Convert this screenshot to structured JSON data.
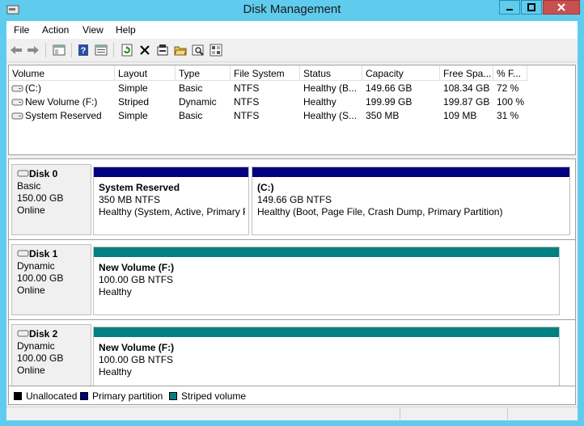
{
  "window": {
    "title": "Disk Management"
  },
  "menu": [
    "File",
    "Action",
    "View",
    "Help"
  ],
  "toolbar": {
    "icons": [
      "back-arrow-icon",
      "forward-arrow-icon",
      "console-tree-icon",
      "help-icon",
      "properties-icon",
      "refresh-icon",
      "delete-icon",
      "new-volume-icon",
      "open-icon",
      "explore-icon",
      "rescan-icon"
    ]
  },
  "volumes": {
    "columns": [
      "Volume",
      "Layout",
      "Type",
      "File System",
      "Status",
      "Capacity",
      "Free Spa...",
      "% F..."
    ],
    "rows": [
      {
        "volume": "(C:)",
        "layout": "Simple",
        "type": "Basic",
        "fs": "NTFS",
        "status": "Healthy (B...",
        "capacity": "149.66 GB",
        "free": "108.34 GB",
        "pct": "72 %"
      },
      {
        "volume": "New Volume (F:)",
        "layout": "Striped",
        "type": "Dynamic",
        "fs": "NTFS",
        "status": "Healthy",
        "capacity": "199.99 GB",
        "free": "199.87 GB",
        "pct": "100 %"
      },
      {
        "volume": "System Reserved",
        "layout": "Simple",
        "type": "Basic",
        "fs": "NTFS",
        "status": "Healthy (S...",
        "capacity": "350 MB",
        "free": "109 MB",
        "pct": "31 %"
      }
    ]
  },
  "disks": [
    {
      "name": "Disk 0",
      "type": "Basic",
      "size": "150.00 GB",
      "state": "Online",
      "partitions": [
        {
          "name": "System Reserved",
          "size": "350 MB NTFS",
          "status": "Healthy (System, Active, Primary P",
          "kind": "primary"
        },
        {
          "name": "(C:)",
          "size": "149.66 GB NTFS",
          "status": "Healthy (Boot, Page File, Crash Dump, Primary Partition)",
          "kind": "primary"
        }
      ]
    },
    {
      "name": "Disk 1",
      "type": "Dynamic",
      "size": "100.00 GB",
      "state": "Online",
      "partitions": [
        {
          "name": "New Volume  (F:)",
          "size": "100.00 GB NTFS",
          "status": "Healthy",
          "kind": "striped"
        }
      ]
    },
    {
      "name": "Disk 2",
      "type": "Dynamic",
      "size": "100.00 GB",
      "state": "Online",
      "partitions": [
        {
          "name": "New Volume  (F:)",
          "size": "100.00 GB NTFS",
          "status": "Healthy",
          "kind": "striped"
        }
      ]
    }
  ],
  "legend": [
    {
      "label": "Unallocated",
      "color": "#000000"
    },
    {
      "label": "Primary partition",
      "color": "#000080"
    },
    {
      "label": "Striped volume",
      "color": "#008080"
    }
  ],
  "colors": {
    "titlebar": "#5fcbed",
    "primary": "#000080",
    "striped": "#008080",
    "close": "#c75050"
  }
}
